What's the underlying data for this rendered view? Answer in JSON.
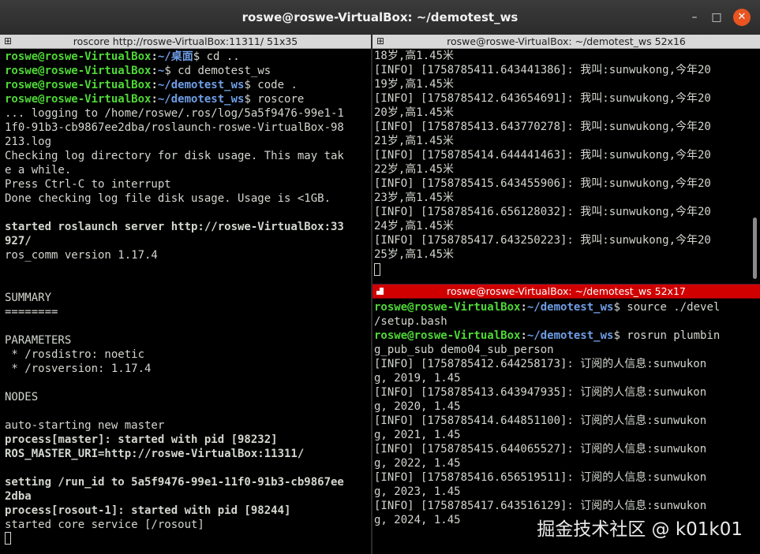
{
  "window": {
    "title": "roswe@roswe-VirtualBox: ~/demotest_ws",
    "min": "–",
    "max": "□",
    "close": "✕"
  },
  "left": {
    "title": "roscore http://roswe-VirtualBox:11311/ 51x35",
    "lines": [
      [
        {
          "t": "roswe@roswe-VirtualBox",
          "c": "g"
        },
        {
          "t": ":",
          "c": "w"
        },
        {
          "t": "~/桌面",
          "c": "b"
        },
        {
          "t": "$ cd ..",
          "c": ""
        }
      ],
      [
        {
          "t": "roswe@roswe-VirtualBox",
          "c": "g"
        },
        {
          "t": ":",
          "c": "w"
        },
        {
          "t": "~",
          "c": "b"
        },
        {
          "t": "$ cd demotest_ws",
          "c": ""
        }
      ],
      [
        {
          "t": "roswe@roswe-VirtualBox",
          "c": "g"
        },
        {
          "t": ":",
          "c": "w"
        },
        {
          "t": "~/demotest_ws",
          "c": "b"
        },
        {
          "t": "$ code .",
          "c": ""
        }
      ],
      [
        {
          "t": "roswe@roswe-VirtualBox",
          "c": "g"
        },
        {
          "t": ":",
          "c": "w"
        },
        {
          "t": "~/demotest_ws",
          "c": "b"
        },
        {
          "t": "$ roscore",
          "c": ""
        }
      ],
      [
        {
          "t": "... logging to /home/roswe/.ros/log/5a5f9476-99e1-1",
          "c": ""
        }
      ],
      [
        {
          "t": "1f0-91b3-cb9867ee2dba/roslaunch-roswe-VirtualBox-98",
          "c": ""
        }
      ],
      [
        {
          "t": "213.log",
          "c": ""
        }
      ],
      [
        {
          "t": "Checking log directory for disk usage. This may tak",
          "c": ""
        }
      ],
      [
        {
          "t": "e a while.",
          "c": ""
        }
      ],
      [
        {
          "t": "Press Ctrl-C to interrupt",
          "c": ""
        }
      ],
      [
        {
          "t": "Done checking log file disk usage. Usage is <1GB.",
          "c": ""
        }
      ],
      [],
      [
        {
          "t": "started roslaunch server http://roswe-VirtualBox:33",
          "c": "w"
        }
      ],
      [
        {
          "t": "927/",
          "c": "w"
        }
      ],
      [
        {
          "t": "ros_comm version 1.17.4",
          "c": ""
        }
      ],
      [],
      [],
      [
        {
          "t": "SUMMARY",
          "c": ""
        }
      ],
      [
        {
          "t": "========",
          "c": ""
        }
      ],
      [],
      [
        {
          "t": "PARAMETERS",
          "c": ""
        }
      ],
      [
        {
          "t": " * /rosdistro: noetic",
          "c": ""
        }
      ],
      [
        {
          "t": " * /rosversion: 1.17.4",
          "c": ""
        }
      ],
      [],
      [
        {
          "t": "NODES",
          "c": ""
        }
      ],
      [],
      [
        {
          "t": "auto-starting new master",
          "c": ""
        }
      ],
      [
        {
          "t": "process[master]: started with pid [98232]",
          "c": "w"
        }
      ],
      [
        {
          "t": "ROS_MASTER_URI=http://roswe-VirtualBox:11311/",
          "c": "w"
        }
      ],
      [],
      [
        {
          "t": "setting /run_id to 5a5f9476-99e1-11f0-91b3-cb9867ee",
          "c": "w"
        }
      ],
      [
        {
          "t": "2dba",
          "c": "w"
        }
      ],
      [
        {
          "t": "process[rosout-1]: started with pid [98244]",
          "c": "w"
        }
      ],
      [
        {
          "t": "started core service [/rosout]",
          "c": ""
        }
      ]
    ]
  },
  "topright": {
    "title": "roswe@roswe-VirtualBox: ~/demotest_ws 52x16",
    "lines": [
      [
        {
          "t": "18岁,高1.45米",
          "c": ""
        }
      ],
      [
        {
          "t": "[INFO] [1758785411.643441386]: 我叫:sunwukong,今年20",
          "c": ""
        }
      ],
      [
        {
          "t": "19岁,高1.45米",
          "c": ""
        }
      ],
      [
        {
          "t": "[INFO] [1758785412.643654691]: 我叫:sunwukong,今年20",
          "c": ""
        }
      ],
      [
        {
          "t": "20岁,高1.45米",
          "c": ""
        }
      ],
      [
        {
          "t": "[INFO] [1758785413.643770278]: 我叫:sunwukong,今年20",
          "c": ""
        }
      ],
      [
        {
          "t": "21岁,高1.45米",
          "c": ""
        }
      ],
      [
        {
          "t": "[INFO] [1758785414.644441463]: 我叫:sunwukong,今年20",
          "c": ""
        }
      ],
      [
        {
          "t": "22岁,高1.45米",
          "c": ""
        }
      ],
      [
        {
          "t": "[INFO] [1758785415.643455906]: 我叫:sunwukong,今年20",
          "c": ""
        }
      ],
      [
        {
          "t": "23岁,高1.45米",
          "c": ""
        }
      ],
      [
        {
          "t": "[INFO] [1758785416.656128032]: 我叫:sunwukong,今年20",
          "c": ""
        }
      ],
      [
        {
          "t": "24岁,高1.45米",
          "c": ""
        }
      ],
      [
        {
          "t": "[INFO] [1758785417.643250223]: 我叫:sunwukong,今年20",
          "c": ""
        }
      ],
      [
        {
          "t": "25岁,高1.45米",
          "c": ""
        }
      ]
    ]
  },
  "bottomright": {
    "title": "roswe@roswe-VirtualBox: ~/demotest_ws 52x17",
    "lines": [
      [
        {
          "t": "roswe@roswe-VirtualBox",
          "c": "g"
        },
        {
          "t": ":",
          "c": "w"
        },
        {
          "t": "~/demotest_ws",
          "c": "b"
        },
        {
          "t": "$ source ./devel",
          "c": ""
        }
      ],
      [
        {
          "t": "/setup.bash",
          "c": ""
        }
      ],
      [
        {
          "t": "roswe@roswe-VirtualBox",
          "c": "g"
        },
        {
          "t": ":",
          "c": "w"
        },
        {
          "t": "~/demotest_ws",
          "c": "b"
        },
        {
          "t": "$ rosrun plumbin",
          "c": ""
        }
      ],
      [
        {
          "t": "g_pub_sub demo04_sub_person",
          "c": ""
        }
      ],
      [
        {
          "t": "[INFO] [1758785412.644258173]: 订阅的人信息:sunwukon",
          "c": ""
        }
      ],
      [
        {
          "t": "g, 2019, 1.45",
          "c": ""
        }
      ],
      [
        {
          "t": "[INFO] [1758785413.643947935]: 订阅的人信息:sunwukon",
          "c": ""
        }
      ],
      [
        {
          "t": "g, 2020, 1.45",
          "c": ""
        }
      ],
      [
        {
          "t": "[INFO] [1758785414.644851100]: 订阅的人信息:sunwukon",
          "c": ""
        }
      ],
      [
        {
          "t": "g, 2021, 1.45",
          "c": ""
        }
      ],
      [
        {
          "t": "[INFO] [1758785415.644065527]: 订阅的人信息:sunwukon",
          "c": ""
        }
      ],
      [
        {
          "t": "g, 2022, 1.45",
          "c": ""
        }
      ],
      [
        {
          "t": "[INFO] [1758785416.656519511]: 订阅的人信息:sunwukon",
          "c": ""
        }
      ],
      [
        {
          "t": "g, 2023, 1.45",
          "c": ""
        }
      ],
      [
        {
          "t": "[INFO] [1758785417.643516129]: 订阅的人信息:sunwukon",
          "c": ""
        }
      ],
      [
        {
          "t": "g, 2024, 1.45",
          "c": ""
        }
      ]
    ]
  },
  "watermark": "掘金技术社区 @ k01k01"
}
